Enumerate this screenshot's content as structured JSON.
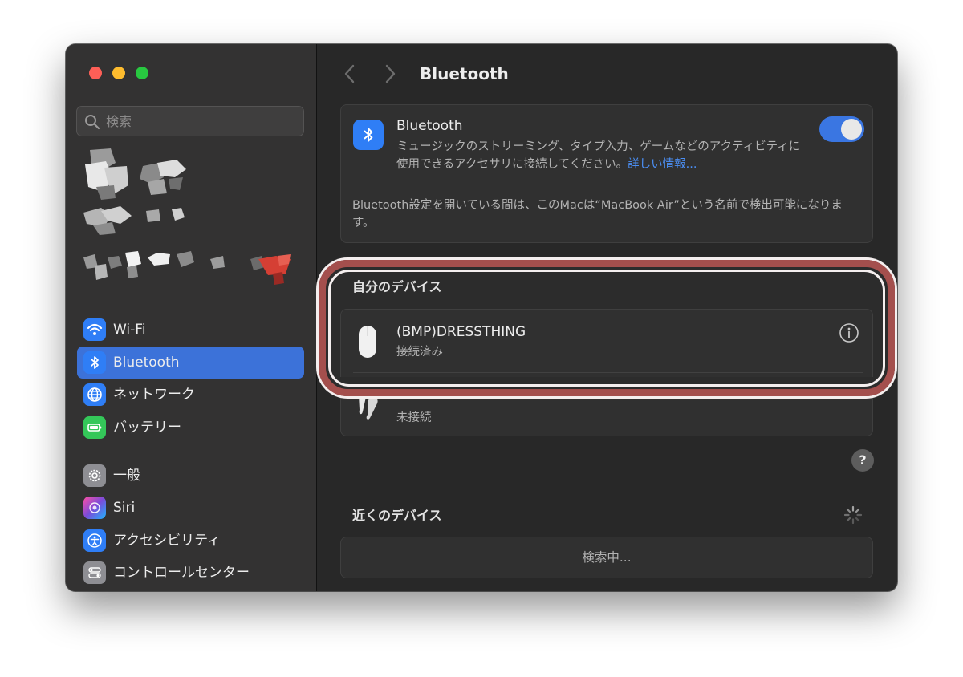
{
  "window": {
    "title": "Bluetooth"
  },
  "sidebar": {
    "search": {
      "placeholder": "検索"
    },
    "items": [
      {
        "label": "Wi-Fi",
        "icon": "wifi-icon",
        "color": "#2f7ef6"
      },
      {
        "label": "Bluetooth",
        "icon": "bluetooth-icon",
        "color": "#2f7ef6",
        "selected": true
      },
      {
        "label": "ネットワーク",
        "icon": "globe-icon",
        "color": "#2f7ef6"
      },
      {
        "label": "バッテリー",
        "icon": "battery-icon",
        "color": "#34c759"
      },
      {
        "label": "一般",
        "icon": "gear-icon",
        "color": "#8e8e93"
      },
      {
        "label": "Siri",
        "icon": "siri-icon",
        "color": "#7a4cd9"
      },
      {
        "label": "アクセシビリティ",
        "icon": "accessibility-icon",
        "color": "#2f7ef6"
      },
      {
        "label": "コントロールセンター",
        "icon": "control-center-icon",
        "color": "#8e8e93"
      }
    ]
  },
  "bluetooth": {
    "title": "Bluetooth",
    "description": "ミュージックのストリーミング、タイプ入力、ゲームなどのアクティビティに使用できるアクセサリに接続してください。",
    "more_link": "詳しい情報...",
    "enabled": true,
    "note": "Bluetooth設定を開いている間は、このMacは“MacBook Air”という名前で検出可能になります。"
  },
  "my_devices": {
    "title": "自分のデバイス",
    "devices": [
      {
        "name": "(BMP)DRESSTHING",
        "status": "接続済み",
        "icon": "mouse-icon"
      },
      {
        "name": "",
        "status": "未接続",
        "icon": "airpods-icon"
      }
    ]
  },
  "nearby": {
    "title": "近くのデバイス",
    "searching": "検索中..."
  },
  "help": {
    "label": "?"
  },
  "colors": {
    "accent": "#3c72d9",
    "link": "#4b8ff5",
    "highlight": "#a44f4d"
  }
}
